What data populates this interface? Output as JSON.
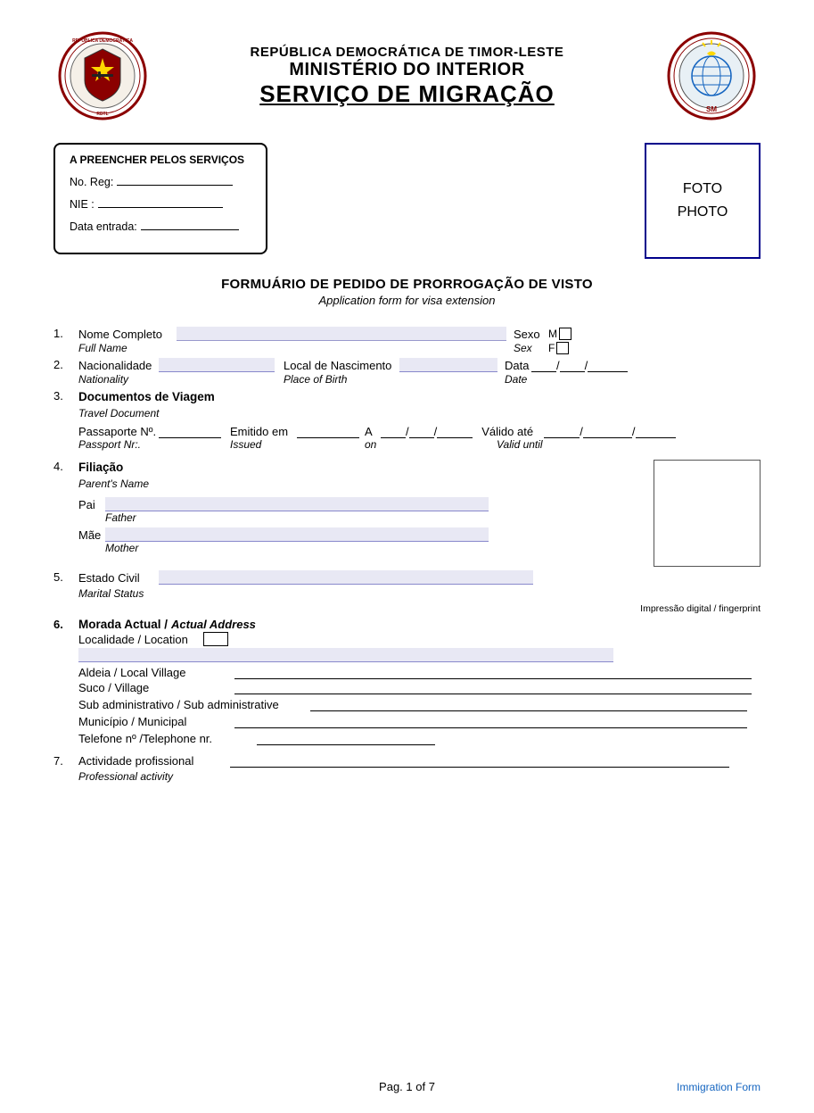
{
  "header": {
    "line1": "REPÚBLICA DEMOCRÁTICA DE TIMOR-LESTE",
    "line2": "MINISTÉRIO DO INTERIOR",
    "line3": "SERVIÇO DE MIGRAÇÃO"
  },
  "admin_box": {
    "title": "A PREENCHER PELOS SERVIÇOS",
    "fields": [
      {
        "label": "No. Reg:",
        "line_width": 130
      },
      {
        "label": "NIE :",
        "line_width": 140
      },
      {
        "label": "Data entrada:",
        "line_width": 120
      }
    ]
  },
  "photo_box": {
    "line1": "FOTO",
    "line2": "PHOTO"
  },
  "form_title": {
    "pt": "FORMUÁRIO DE PEDIDO DE PRORROGAÇÃO DE VISTO",
    "en": "Application form for visa extension"
  },
  "fields": {
    "field1_pt": "Nome Completo",
    "field1_en": "Full Name",
    "sexo_pt": "Sexo",
    "sexo_en": "Sex",
    "sex_m": "M",
    "sex_f": "F",
    "field2_pt": "Nacionalidade",
    "field2_en": "Nationality",
    "local_pt": "Local de Nascimento",
    "local_en": "Place of Birth",
    "data_pt": "Data",
    "data_en": "Date",
    "field3_pt": "Documentos de Viagem",
    "field3_en": "Travel Document",
    "passaporte_pt": "Passaporte Nº.",
    "passaporte_en": "Passport Nr:.",
    "emitido_pt": "Emitido em",
    "emitido_en": "Issued",
    "a_pt": "A",
    "on_en": "on",
    "valido_pt": "Válido até",
    "valido_en": "Valid until",
    "field4_pt": "Filiação",
    "field4_en": "Parent's Name",
    "pai_pt": "Pai",
    "pai_en": "Father",
    "mae_pt": "Mãe",
    "mae_en": "Mother",
    "field5_pt": "Estado Civil",
    "field5_en": "Marital Status",
    "fp_label": "Impressão digital / fingerprint",
    "field6_pt": "Morada Actual",
    "field6_en": "Actual Address",
    "localidade_pt": "Localidade / Location",
    "aldeia_pt": "Aldeia / Local Village",
    "suco_pt": "Suco / Village",
    "sub_admin_pt": "Sub administrativo / Sub administrative",
    "municipio_pt": "Município / Municipal",
    "telefone_pt": "Telefone nº /Telephone nr.",
    "field7_pt": "Actividade profissional",
    "field7_en": "Professional activity"
  },
  "footer": {
    "page_text": "Pag. 1 of 7",
    "immigration_label": "Immigration Form"
  }
}
